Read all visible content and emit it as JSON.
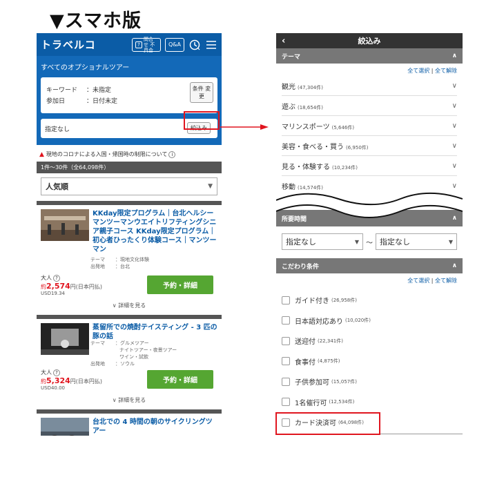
{
  "page_title": "▼スマホ版",
  "colors": {
    "header_blue": "#0b5ca6",
    "book_green": "#55a632",
    "price_red": "#e0141e",
    "highlight_red": "#e0141e"
  },
  "left": {
    "logo": "トラベルコ",
    "header_buttons": [
      {
        "label": "問合せ 不具合",
        "icon": "question-icon"
      },
      {
        "label": "Q&A"
      }
    ],
    "section_title": "すべてのオプショナルツアー",
    "search": {
      "keyword_label": "キーワード",
      "keyword_value": "未指定",
      "date_label": "参加日",
      "date_value": "日付未定",
      "change_button": "条件 変更"
    },
    "filter": {
      "value": "指定なし",
      "button": "絞込み"
    },
    "notice": "現地のコロナによる入国・帰国時の制限について",
    "count": "1件〜30件（全64,098件）",
    "sort": "人気順",
    "results": [
      {
        "title": "KKday限定プログラム｜台北ヘルシーマンツーマンウエイトリフティングシニア親子コース KKday限定プログラム｜初心者ひったくり体験コース｜マンツーマン",
        "meta": [
          {
            "k": "テーマ",
            "v": "：現地文化体験"
          },
          {
            "k": "出発地",
            "v": "：台北"
          }
        ],
        "adult": "大人",
        "price_prefix": "約",
        "price": "2,574",
        "price_suffix": "円(日本円払)",
        "usd": "USD19.34",
        "book": "予約・詳細",
        "detail": "詳細を見る"
      },
      {
        "title": "蒸留所での焼酎テイスティング - 3 匹の豚の話",
        "meta": [
          {
            "k": "テーマ",
            "v": "：グルメツアー"
          },
          {
            "k": "",
            "v": "ナイトツアー・夜景ツアー"
          },
          {
            "k": "",
            "v": "ワイン・試飲"
          },
          {
            "k": "出発地",
            "v": "：ソウル"
          }
        ],
        "adult": "大人",
        "price_prefix": "約",
        "price": "5,324",
        "price_suffix": "円(日本円払)",
        "usd": "USD40.00",
        "book": "予約・詳細",
        "detail": "詳細を見る"
      },
      {
        "title": "台北での 4 時間の朝のサイクリングツアー"
      }
    ]
  },
  "right": {
    "title": "絞込み",
    "back": "‹",
    "theme_section": "テーマ",
    "select_all": "全て選択",
    "clear_all": "全て解除",
    "themes": [
      {
        "label": "観光",
        "count": "(47,304件)"
      },
      {
        "label": "遊ぶ",
        "count": "(18,654件)"
      },
      {
        "label": "マリンスポーツ",
        "count": "(5,646件)"
      },
      {
        "label": "美容・食べる・買う",
        "count": "(6,950件)"
      },
      {
        "label": "見る・体験する",
        "count": "(10,234件)"
      },
      {
        "label": "移動",
        "count": "(14,574件)"
      }
    ],
    "time_section": "所要時間",
    "time_from": "指定なし",
    "time_to": "指定なし",
    "tilde": "〜",
    "kodawari_section": "こだわり条件",
    "conditions": [
      {
        "label": "ガイド付き",
        "count": "(26,958件)"
      },
      {
        "label": "日本語対応あり",
        "count": "(10,020件)"
      },
      {
        "label": "送迎付",
        "count": "(22,341件)"
      },
      {
        "label": "食事付",
        "count": "(4,875件)"
      },
      {
        "label": "子供参加可",
        "count": "(15,057件)"
      },
      {
        "label": "1名催行可",
        "count": "(12,534件)"
      },
      {
        "label": "カード決済可",
        "count": "(64,098件)"
      }
    ]
  }
}
